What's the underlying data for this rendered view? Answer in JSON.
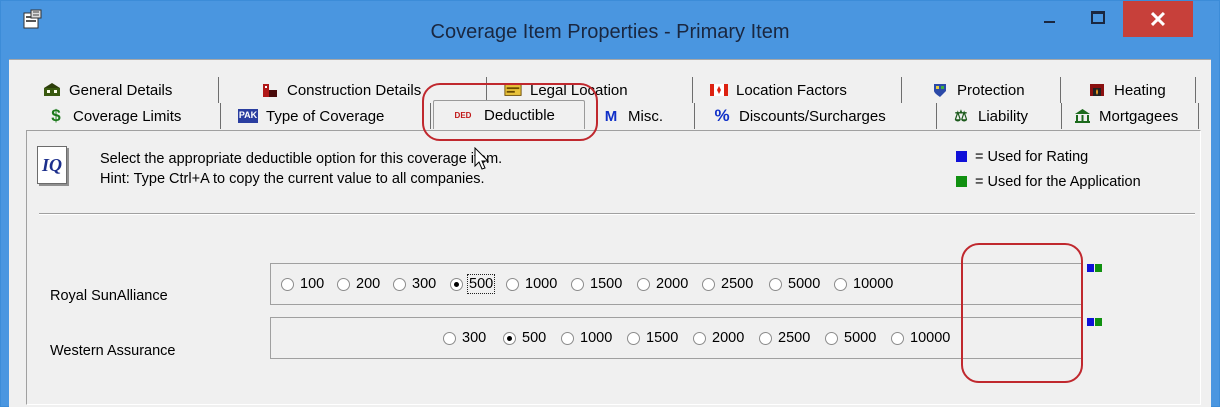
{
  "window": {
    "title": "Coverage Item Properties - Primary Item",
    "close_glyph": "✕"
  },
  "tabs_back": [
    {
      "label": "General Details",
      "icon": "house-icon"
    },
    {
      "label": "Construction Details",
      "icon": "building-icon"
    },
    {
      "label": "Legal Location",
      "icon": "map-icon"
    },
    {
      "label": "Location Factors",
      "icon": "canada-flag-icon"
    },
    {
      "label": "Protection",
      "icon": "shield-icon"
    },
    {
      "label": "Heating",
      "icon": "fireplace-icon"
    }
  ],
  "tabs_front": [
    {
      "label": "Coverage Limits",
      "icon": "dollar-icon",
      "glyph": "$"
    },
    {
      "label": "Type of Coverage",
      "icon": "pak-icon",
      "glyph": "PAK"
    },
    {
      "label": "Deductible",
      "icon": "ded-icon",
      "glyph": "DED",
      "active": true
    },
    {
      "label": "Misc.",
      "icon": "m-icon",
      "glyph": "M"
    },
    {
      "label": "Discounts/Surcharges",
      "icon": "percent-icon",
      "glyph": "%"
    },
    {
      "label": "Liability",
      "icon": "scales-icon",
      "glyph": "⚖"
    },
    {
      "label": "Mortgagees",
      "icon": "bank-icon",
      "glyph": "🏛"
    }
  ],
  "instructions": {
    "line1": "Select the appropriate deductible option for this coverage item.",
    "line2": "Hint: Type Ctrl+A to copy the current value to all companies.",
    "icon_text": "IQ"
  },
  "legend": {
    "rating": "= Used for Rating",
    "application": "= Used for the Application",
    "rating_color": "#1010d8",
    "application_color": "#109010"
  },
  "companies": [
    {
      "name": "Royal SunAlliance",
      "options": [
        "100",
        "200",
        "300",
        "500",
        "1000",
        "1500",
        "2000",
        "2500",
        "5000",
        "10000"
      ],
      "selected": "500"
    },
    {
      "name": "Western Assurance",
      "options": [
        "300",
        "500",
        "1000",
        "1500",
        "2000",
        "2500",
        "5000",
        "10000"
      ],
      "selected": "500"
    }
  ],
  "colors": {
    "titlebar": "#4a96e0",
    "close": "#c7403a",
    "callout": "#c0282e"
  }
}
